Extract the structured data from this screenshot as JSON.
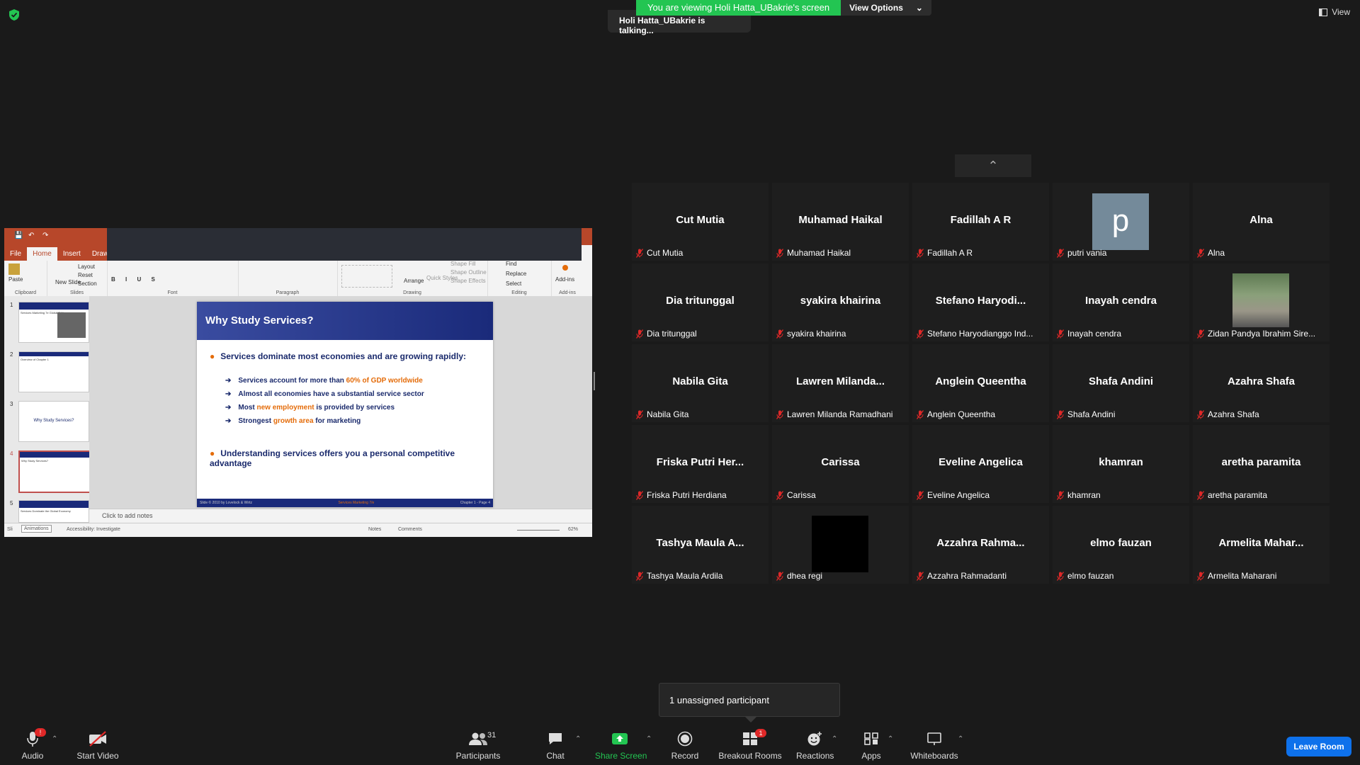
{
  "banner": {
    "viewing": "You are viewing Holi Hatta_UBakrie's screen",
    "view_options": "View Options"
  },
  "talking": "Holi Hatta_UBakrie is talking...",
  "view_button": "View",
  "ppt": {
    "tabs": [
      "File",
      "Home",
      "Insert",
      "Draw"
    ],
    "ribbon": {
      "clipboard": "Clipboard",
      "slides": "Slides",
      "font": "Font",
      "paragraph": "Paragraph",
      "drawing": "Drawing",
      "editing": "Editing",
      "addins": "Add-ins",
      "paste": "Paste",
      "new_slide": "New Slide",
      "layout": "Layout",
      "reset": "Reset",
      "section": "Section",
      "arrange": "Arrange",
      "quick_styles": "Quick Styles",
      "shape_fill": "Shape Fill",
      "shape_outline": "Shape Outline",
      "shape_effects": "Shape Effects",
      "find": "Find",
      "replace": "Replace",
      "select": "Select",
      "addins_btn": "Add-ins"
    },
    "thumbs": [
      {
        "num": "1",
        "text": "Services Marketing 7e Global Edition"
      },
      {
        "num": "2",
        "text": "Overview of Chapter 1"
      },
      {
        "num": "3",
        "text": "Why Study Services?"
      },
      {
        "num": "4",
        "text": "Why Study Services?"
      },
      {
        "num": "5",
        "text": "Services Dominate the Global Economy"
      }
    ],
    "slide": {
      "title": "Why Study Services?",
      "bullet1": "Services dominate most economies and are growing rapidly:",
      "sub1_a": "Services account for more than ",
      "sub1_b": "60% of GDP worldwide",
      "sub2": "Almost all economies have a substantial service sector",
      "sub3_a": "Most ",
      "sub3_b": "new employment",
      "sub3_c": " is provided by services",
      "sub4_a": "Strongest ",
      "sub4_b": "growth area",
      "sub4_c": " for marketing",
      "bullet2": "Understanding services offers you a personal competitive advantage",
      "footer_left": "Slide © 2010 by Lovelock & Wirtz",
      "footer_mid": "Services Marketing 7/e",
      "footer_right": "Chapter 1 - Page 4"
    },
    "notes": "Click to add notes",
    "status": {
      "slide": "Sli",
      "animations": "Animations",
      "accessibility": "Accessibility: Investigate",
      "notes": "Notes",
      "comments": "Comments",
      "zoom": "62%"
    }
  },
  "participants": [
    {
      "big": "Cut Mutia",
      "small": "Cut Mutia"
    },
    {
      "big": "Muhamad Haikal",
      "small": "Muhamad Haikal"
    },
    {
      "big": "Fadillah A R",
      "small": "Fadillah A R"
    },
    {
      "big": "p",
      "small": "putri vania",
      "avatar": "letter"
    },
    {
      "big": "Alna",
      "small": "Alna"
    },
    {
      "big": "Dia tritunggal",
      "small": "Dia tritunggal"
    },
    {
      "big": "syakira khairina",
      "small": "syakira khairina"
    },
    {
      "big": "Stefano  Haryodi...",
      "small": "Stefano Haryodianggo Ind..."
    },
    {
      "big": "Inayah cendra",
      "small": "Inayah cendra"
    },
    {
      "big": "",
      "small": "Zidan Pandya Ibrahim Sire...",
      "avatar": "photo"
    },
    {
      "big": "Nabila Gita",
      "small": "Nabila Gita"
    },
    {
      "big": "Lawren  Milanda...",
      "small": "Lawren Milanda Ramadhani"
    },
    {
      "big": "Anglein Queentha",
      "small": "Anglein Queentha"
    },
    {
      "big": "Shafa Andini",
      "small": "Shafa Andini"
    },
    {
      "big": "Azahra Shafa",
      "small": "Azahra Shafa"
    },
    {
      "big": "Friska  Putri  Her...",
      "small": "Friska Putri Herdiana"
    },
    {
      "big": "Carissa",
      "small": "Carissa"
    },
    {
      "big": "Eveline Angelica",
      "small": "Eveline Angelica"
    },
    {
      "big": "khamran",
      "small": "khamran"
    },
    {
      "big": "aretha paramita",
      "small": "aretha paramita"
    },
    {
      "big": "Tashya Maula A...",
      "small": "Tashya Maula Ardila"
    },
    {
      "big": "",
      "small": "dhea regi",
      "avatar": "black"
    },
    {
      "big": "Azzahra  Rahma...",
      "small": "Azzahra Rahmadanti"
    },
    {
      "big": "elmo fauzan",
      "small": "elmo fauzan"
    },
    {
      "big": "Armelita  Mahar...",
      "small": "Armelita Maharani"
    }
  ],
  "popup": "1 unassigned participant",
  "toolbar": {
    "audio": "Audio",
    "audio_badge": "!",
    "video": "Start Video",
    "participants": "Participants",
    "participants_count": "31",
    "chat": "Chat",
    "share": "Share Screen",
    "record": "Record",
    "breakout": "Breakout Rooms",
    "breakout_badge": "1",
    "reactions": "Reactions",
    "apps": "Apps",
    "whiteboards": "Whiteboards",
    "leave": "Leave Room"
  },
  "colors": {
    "share_green": "#23c552",
    "leave_blue": "#0e71eb",
    "mic_red": "#e02828",
    "ppt_red": "#b7472a",
    "slide_navy": "#1a2a7a",
    "accent_orange": "#e46c0a"
  }
}
